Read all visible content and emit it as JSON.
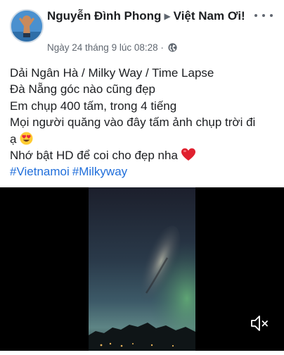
{
  "post": {
    "author": "Nguyễn Đình Phong",
    "page": "Việt Nam Ơi!",
    "timestamp": "Ngày 24 tháng 9 lúc 08:28",
    "audience_icon": "globe-icon",
    "lines": [
      "Dải Ngân Hà / Milky Way / Time Lapse",
      "Đà Nẵng góc nào cũng đẹp",
      "Em chụp 400 tấm, trong 4 tiếng",
      "Mọi người quăng vào đây tấm ảnh chụp trời đi",
      "ạ",
      "Nhớ bật HD để coi cho đẹp nha"
    ],
    "hashtags": [
      "#Vietnamoi",
      "#Milkyway"
    ]
  },
  "colors": {
    "text": "#1c1e21",
    "secondary": "#606770",
    "link": "#216fdb",
    "video_bg": "#000000"
  },
  "video": {
    "mute_icon": "speaker-muted-icon"
  }
}
